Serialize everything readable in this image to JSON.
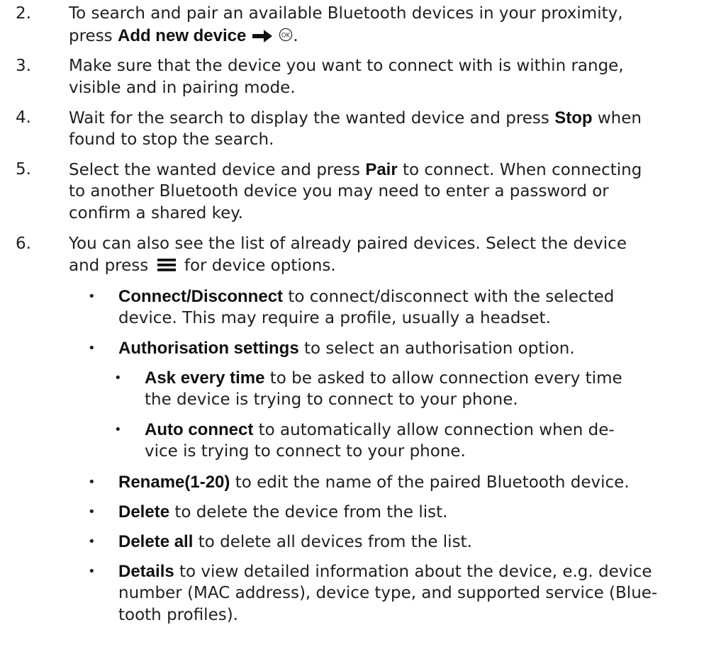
{
  "steps": [
    {
      "number": "2.",
      "lines": [
        "To search and pair an available Bluetooth devices in your proximity,",
        {
          "pre": "press ",
          "bold": "Add new device",
          "post": "."
        }
      ]
    },
    {
      "number": "3.",
      "lines": [
        "Make sure that the device you want to connect with is within range,",
        "visible and in pairing mode."
      ]
    },
    {
      "number": "4.",
      "lines": [
        {
          "pre": "Wait for the search to display the wanted device and press ",
          "bold": "Stop",
          "post": " when"
        },
        "found to stop the search."
      ]
    },
    {
      "number": "5.",
      "lines": [
        {
          "pre": "Select the wanted device and press ",
          "bold": "Pair",
          "post": " to connect. When connecting"
        },
        "to another Bluetooth device you may need to enter a password or",
        "confirm a shared key."
      ]
    },
    {
      "number": "6.",
      "lines": [
        "You can also see the list of already paired devices. Select the device",
        {
          "pre": "and press ",
          "post": " for device options."
        }
      ]
    }
  ],
  "options": [
    {
      "bold": "Connect/Disconnect",
      "text": " to connect/disconnect with the selected",
      "cont": "device. This may require a profile, usually a headset."
    },
    {
      "bold": "Authorisation settings",
      "text": " to select an authorisation option."
    },
    {
      "bold": "Ask every time",
      "text": " to be asked to allow connection every time",
      "cont": "the device is trying to connect to your phone."
    },
    {
      "bold": "Auto connect",
      "text": " to automatically allow connection when de-",
      "cont": "vice is trying to connect to your phone."
    },
    {
      "bold": "Rename",
      "bold2": "(1-20)",
      "text": " to edit the name of the paired Bluetooth device."
    },
    {
      "bold": "Delete",
      "text": " to delete the device from the list."
    },
    {
      "bold": "Delete all",
      "text": " to delete all devices from the list."
    },
    {
      "bold": "Details",
      "text": " to view detailed information about the device, e.g. device",
      "cont": "number (MAC address), device type, and supported service (Blue-",
      "cont2": "tooth profiles)."
    }
  ],
  "bullet": "•",
  "icons": {
    "arrow": "arrow-right-icon",
    "ok": "ok-key-icon",
    "menu": "menu-key-icon"
  }
}
